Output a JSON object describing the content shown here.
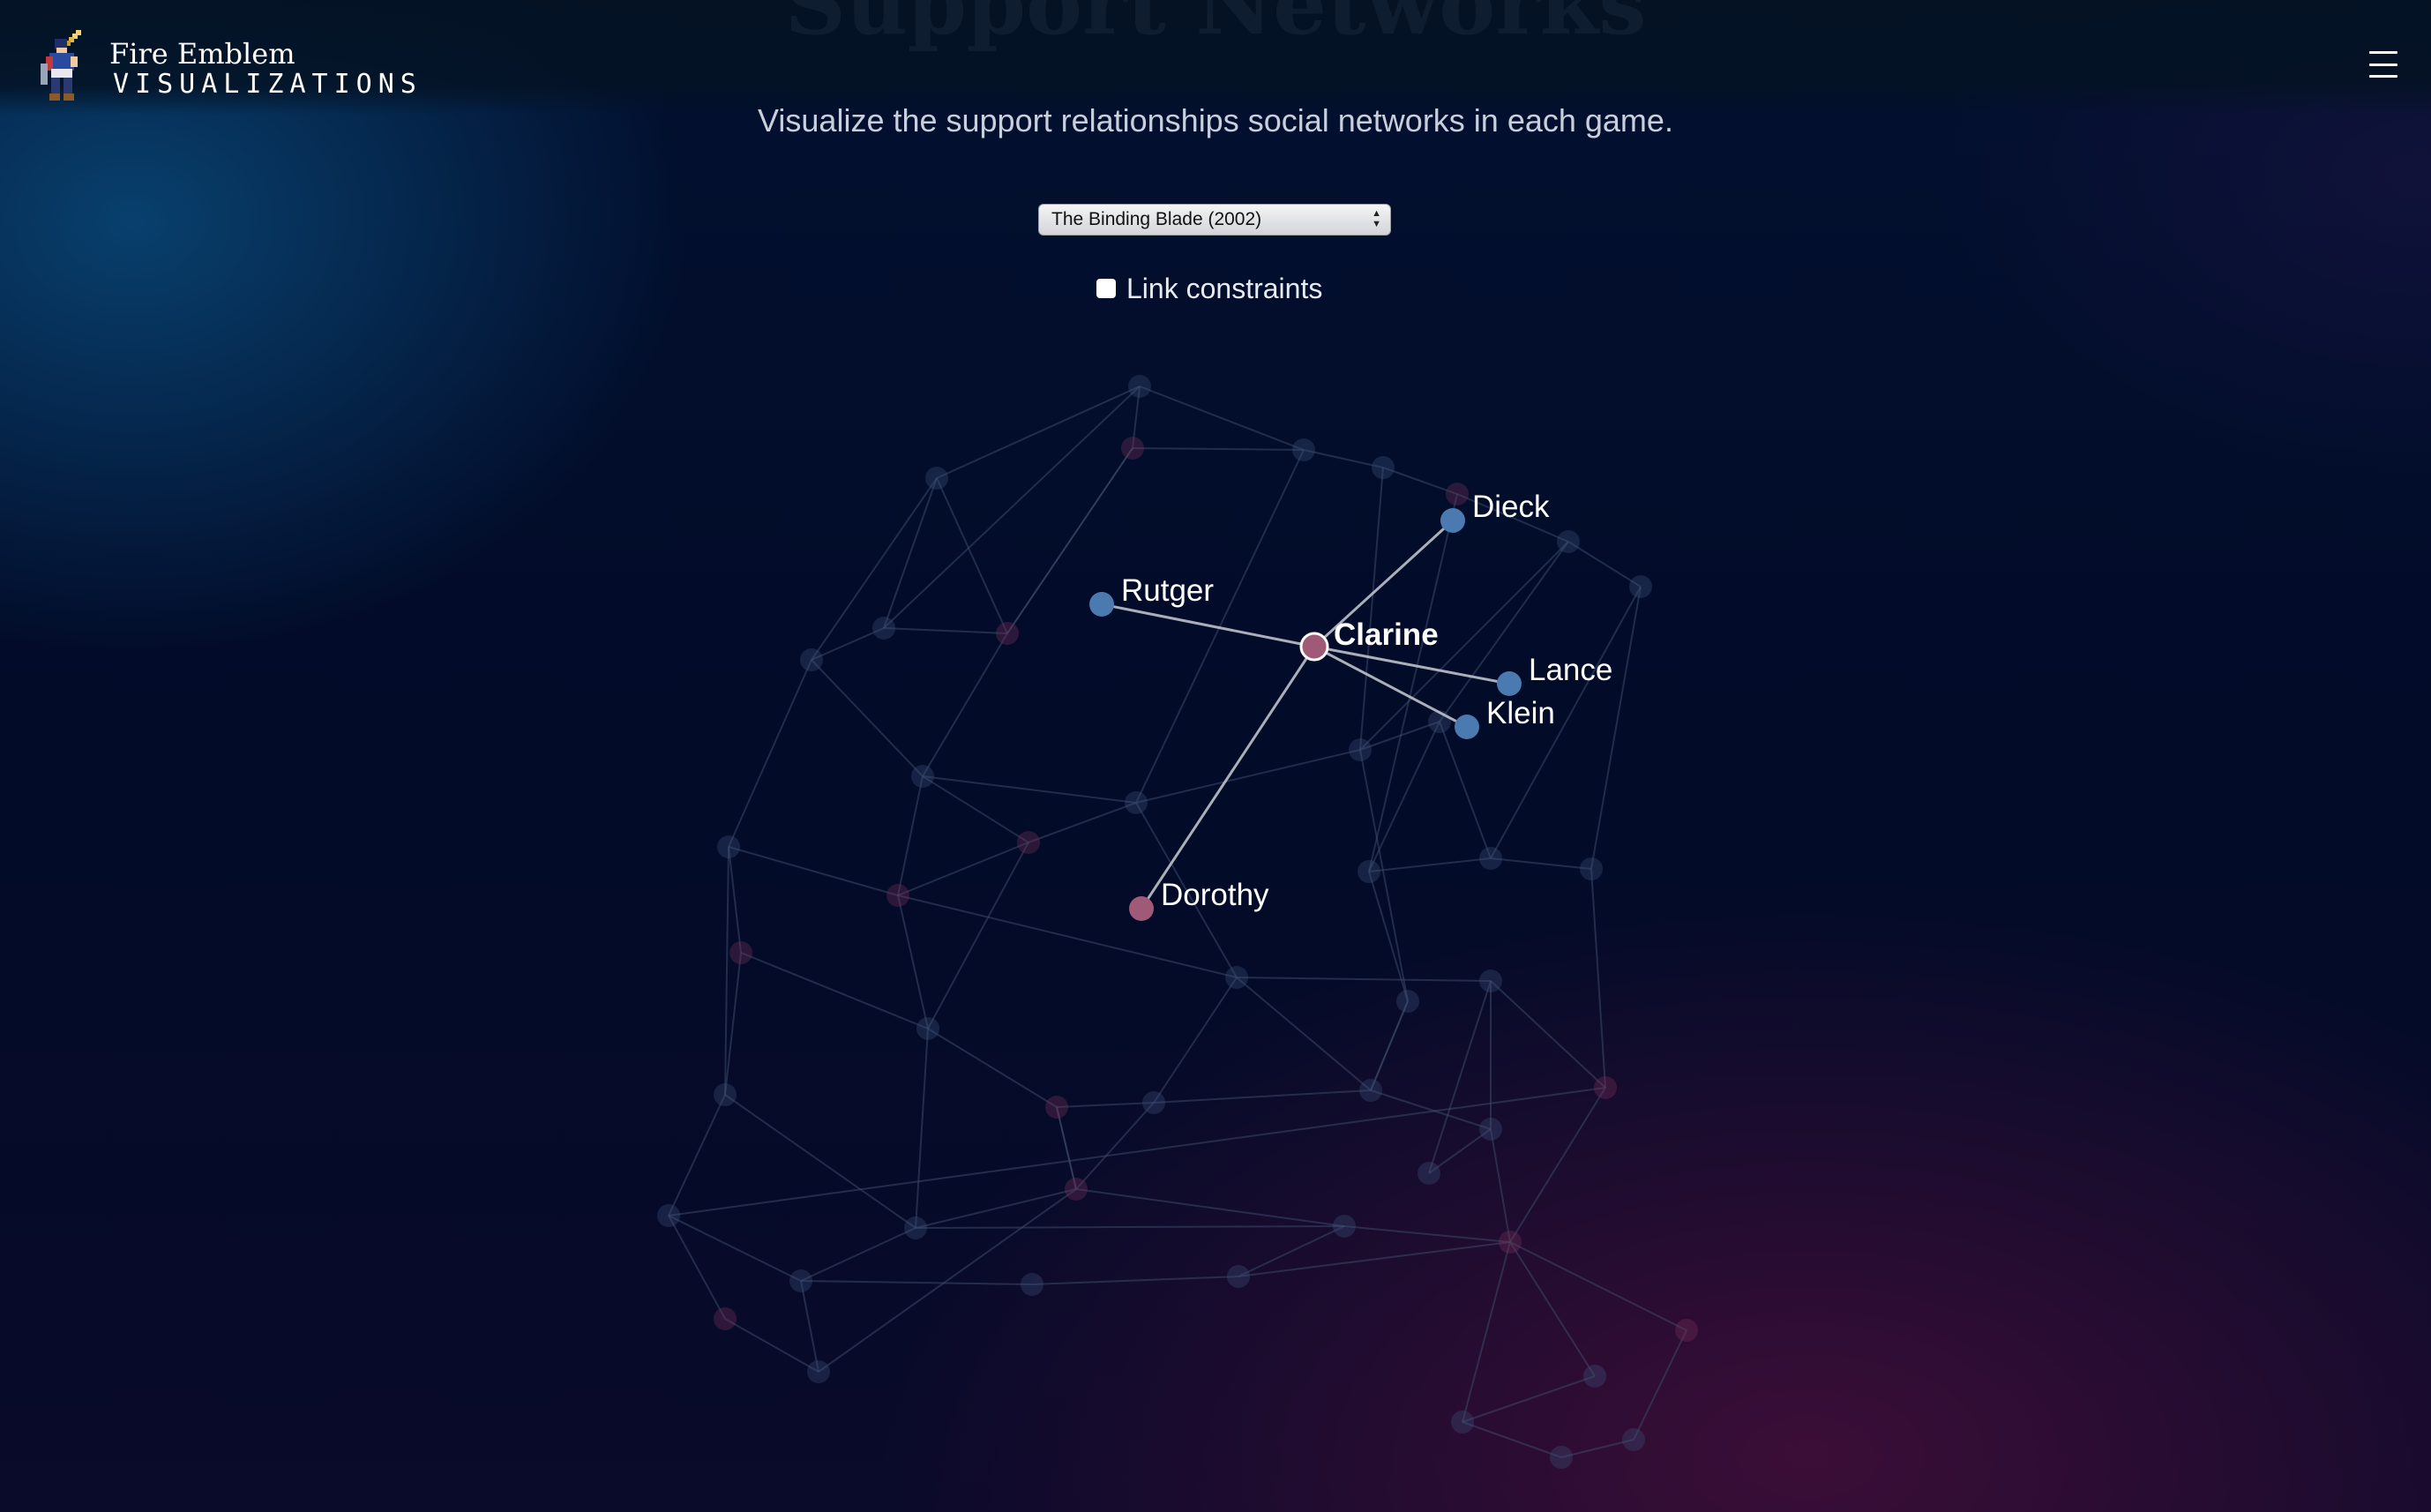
{
  "header": {
    "title_ghost": "Support Networks",
    "logo_line1": "Fire Emblem",
    "logo_line2": "VISUALIZATIONS",
    "menu_icon": "hamburger-menu-icon"
  },
  "subtitle": "Visualize the support relationships social networks in each game.",
  "game_select": {
    "value": "The Binding Blade (2002)"
  },
  "link_constraints": {
    "label": "Link constraints",
    "checked": false
  },
  "colors": {
    "male_node": "#4b7ab0",
    "female_node": "#a05a78",
    "focus_link": "#c8ccd4",
    "background_link": "#3c4868"
  },
  "graph": {
    "focus_character": "Clarine",
    "highlighted_nodes": [
      {
        "name": "Clarine",
        "type": "female",
        "focus": true
      },
      {
        "name": "Dieck",
        "type": "male"
      },
      {
        "name": "Rutger",
        "type": "male"
      },
      {
        "name": "Lance",
        "type": "male"
      },
      {
        "name": "Klein",
        "type": "male"
      },
      {
        "name": "Dorothy",
        "type": "female"
      }
    ],
    "highlighted_links": [
      [
        "Clarine",
        "Dieck"
      ],
      [
        "Clarine",
        "Rutger"
      ],
      [
        "Clarine",
        "Lance"
      ],
      [
        "Clarine",
        "Klein"
      ],
      [
        "Clarine",
        "Dorothy"
      ]
    ]
  }
}
